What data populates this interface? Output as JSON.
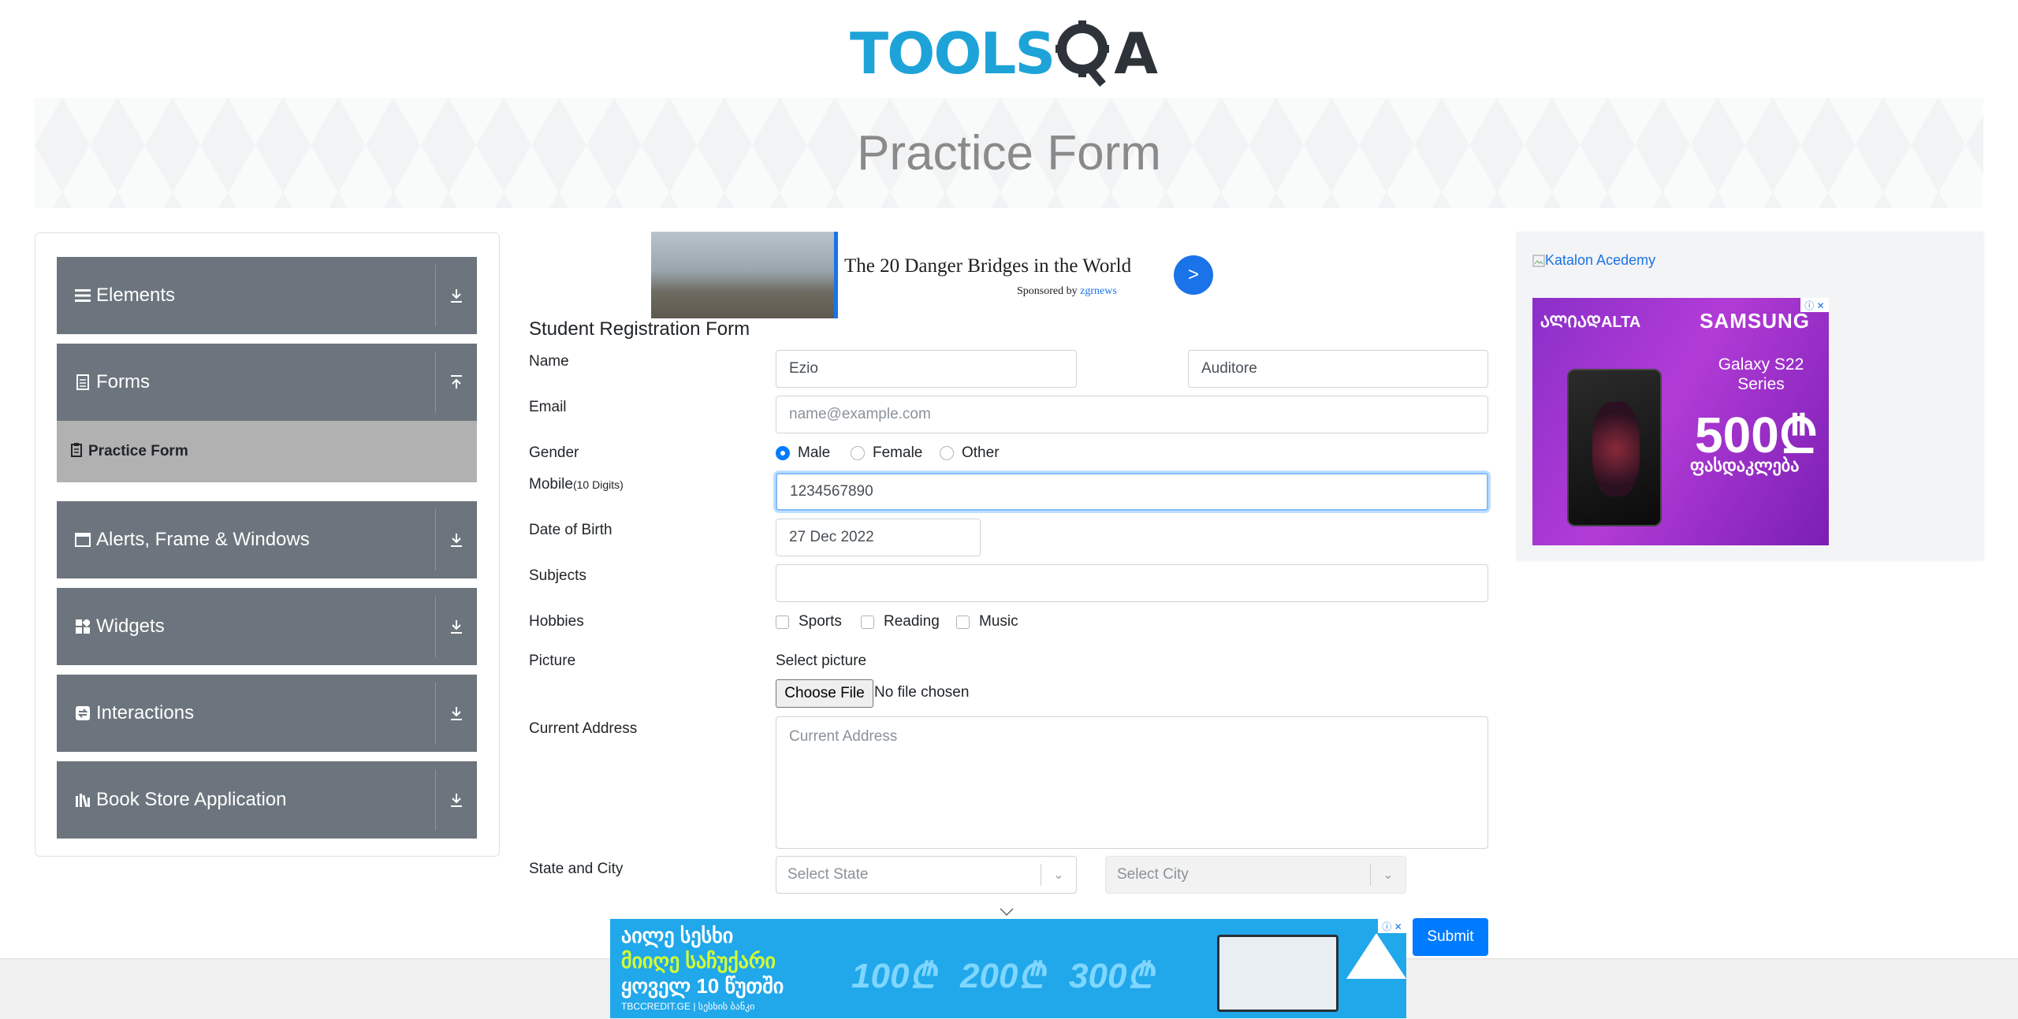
{
  "header": {
    "logo_tools": "TOOLS",
    "logo_qa": "A"
  },
  "banner": {
    "title": "Practice Form"
  },
  "sidebar": {
    "groups": [
      {
        "label": "Elements",
        "icon": "menu-icon",
        "expanded": false
      },
      {
        "label": "Forms",
        "icon": "document-icon",
        "expanded": true
      },
      {
        "label": "Alerts, Frame & Windows",
        "icon": "window-icon",
        "expanded": false
      },
      {
        "label": "Widgets",
        "icon": "grid-icon",
        "expanded": false
      },
      {
        "label": "Interactions",
        "icon": "interactions-icon",
        "expanded": false
      },
      {
        "label": "Book Store Application",
        "icon": "books-icon",
        "expanded": false
      }
    ],
    "sub_item": {
      "label": "Practice Form",
      "icon": "clipboard-icon"
    }
  },
  "ad_top": {
    "headline": "The 20 Danger Bridges in the World",
    "sponsored_by": "Sponsored by",
    "sponsor": "zgrnews",
    "go": ">"
  },
  "form": {
    "heading": "Student Registration Form",
    "name_label": "Name",
    "first_name": "Ezio",
    "last_name": "Auditore",
    "email_label": "Email",
    "email_placeholder": "name@example.com",
    "gender_label": "Gender",
    "genders": [
      "Male",
      "Female",
      "Other"
    ],
    "gender_selected": "Male",
    "mobile_label": "Mobile",
    "mobile_hint": "(10 Digits)",
    "mobile": "1234567890",
    "dob_label": "Date of Birth",
    "dob": "27 Dec 2022",
    "subjects_label": "Subjects",
    "subjects": "",
    "hobbies_label": "Hobbies",
    "hobbies": [
      "Sports",
      "Reading",
      "Music"
    ],
    "picture_label": "Picture",
    "select_picture": "Select picture",
    "choose_file": "Choose File",
    "no_file": "No file chosen",
    "address_label": "Current Address",
    "address_placeholder": "Current Address",
    "state_city_label": "State and City",
    "state_placeholder": "Select State",
    "city_placeholder": "Select City",
    "submit": "Submit"
  },
  "ad_right": {
    "link_text": "Katalon Acedemy",
    "brand": "SAMSUNG",
    "left_brand": "ᲐᲚᲘᲐᲓALTA",
    "model": "Galaxy S22 Series",
    "price": "500₾",
    "price_caption": "ფასდაკლება"
  },
  "ad_bottom": {
    "line1": "აილე სესხი",
    "line2": "მიიღე საჩუქარი",
    "line3": "ყოველ 10 წუთში",
    "footer": "TBCCREDIT.GE | სესხის ბანკი",
    "amounts": [
      "100₾",
      "200₾",
      "300₾"
    ]
  },
  "colors": {
    "brand_blue": "#1ea3d8",
    "sidebar_bg": "#6c757d",
    "active_item_bg": "#b1b1b1",
    "primary": "#007bff"
  }
}
